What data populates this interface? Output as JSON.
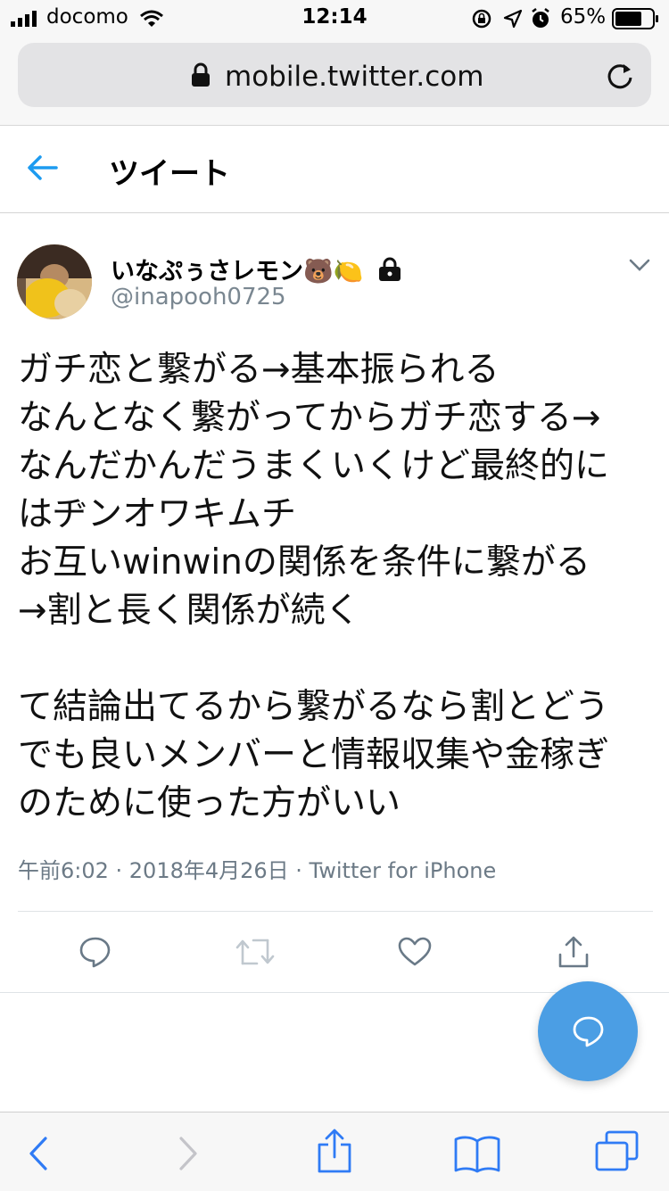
{
  "status_bar": {
    "carrier": "docomo",
    "time": "12:14",
    "battery_percent": "65%"
  },
  "browser": {
    "url": "mobile.twitter.com"
  },
  "header": {
    "title": "ツイート"
  },
  "tweet": {
    "display_name": "いなぷぅさレモン",
    "name_emojis": "🐻🍋",
    "handle": "@inapooh0725",
    "text": "ガチ恋と繋がる→基本振られる\nなんとなく繋がってからガチ恋する→\nなんだかんだうまくいくけど最終的に\nはヂンオワキムチ\nお互いwinwinの関係を条件に繋がる\n→割と長く関係が続く\n\nて結論出てるから繋がるなら割とどう\nでも良いメンバーと情報収集や金稼ぎ\nのために使った方がいい",
    "timestamp": "午前6:02 · 2018年4月26日 · Twitter for iPhone"
  },
  "colors": {
    "accent": "#4b9ee4",
    "secondary_text": "#6c7a86",
    "action_icon": "#697987",
    "safari_blue": "#2f7bf5"
  },
  "icons": {
    "back": "arrow-left-icon",
    "lock": "padlock-icon",
    "reload": "reload-icon",
    "caret": "chevron-down-icon",
    "reply": "speech-bubble-icon",
    "retweet": "retweet-icon",
    "like": "heart-icon",
    "share": "share-icon",
    "compose": "compose-bubble-icon"
  }
}
